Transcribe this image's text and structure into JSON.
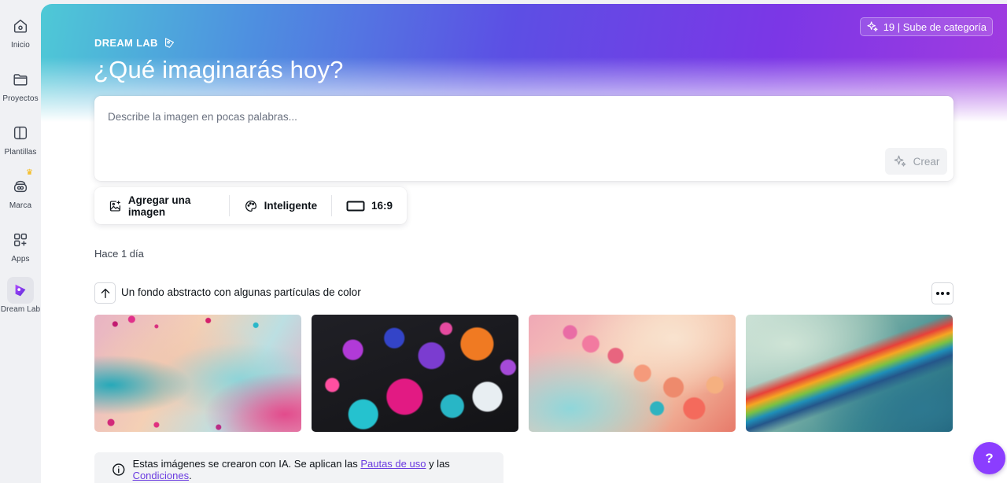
{
  "nav": {
    "items": [
      {
        "label": "Inicio",
        "icon": "home-icon"
      },
      {
        "label": "Proyectos",
        "icon": "folder-icon"
      },
      {
        "label": "Plantillas",
        "icon": "templates-icon"
      },
      {
        "label": "Marca",
        "icon": "brand-kit-icon"
      },
      {
        "label": "Apps",
        "icon": "apps-icon"
      },
      {
        "label": "Dream Lab",
        "icon": "dream-lab-icon"
      }
    ]
  },
  "header": {
    "upgrade_label": "19 | Sube de categoría",
    "brand": "DREAM LAB",
    "headline": "¿Qué imaginarás hoy?"
  },
  "prompt": {
    "placeholder": "Describe la imagen en pocas palabras...",
    "value": "",
    "create_label": "Crear"
  },
  "options": {
    "add_image_label": "Agregar una imagen",
    "style_label": "Inteligente",
    "aspect_label": "16:9"
  },
  "history": {
    "time_label": "Hace 1 día",
    "prompt_text": "Un fondo abstracto con algunas partículas de color"
  },
  "disclaimer": {
    "text_before": "Estas imágenes se crearon con IA. Se aplican las ",
    "link1": "Pautas de uso",
    "text_mid": " y las ",
    "link2": "Condiciones",
    "text_end": "."
  },
  "help": {
    "label": "?"
  },
  "colors": {
    "accent": "#8b3dff",
    "link": "#6a3be0"
  }
}
